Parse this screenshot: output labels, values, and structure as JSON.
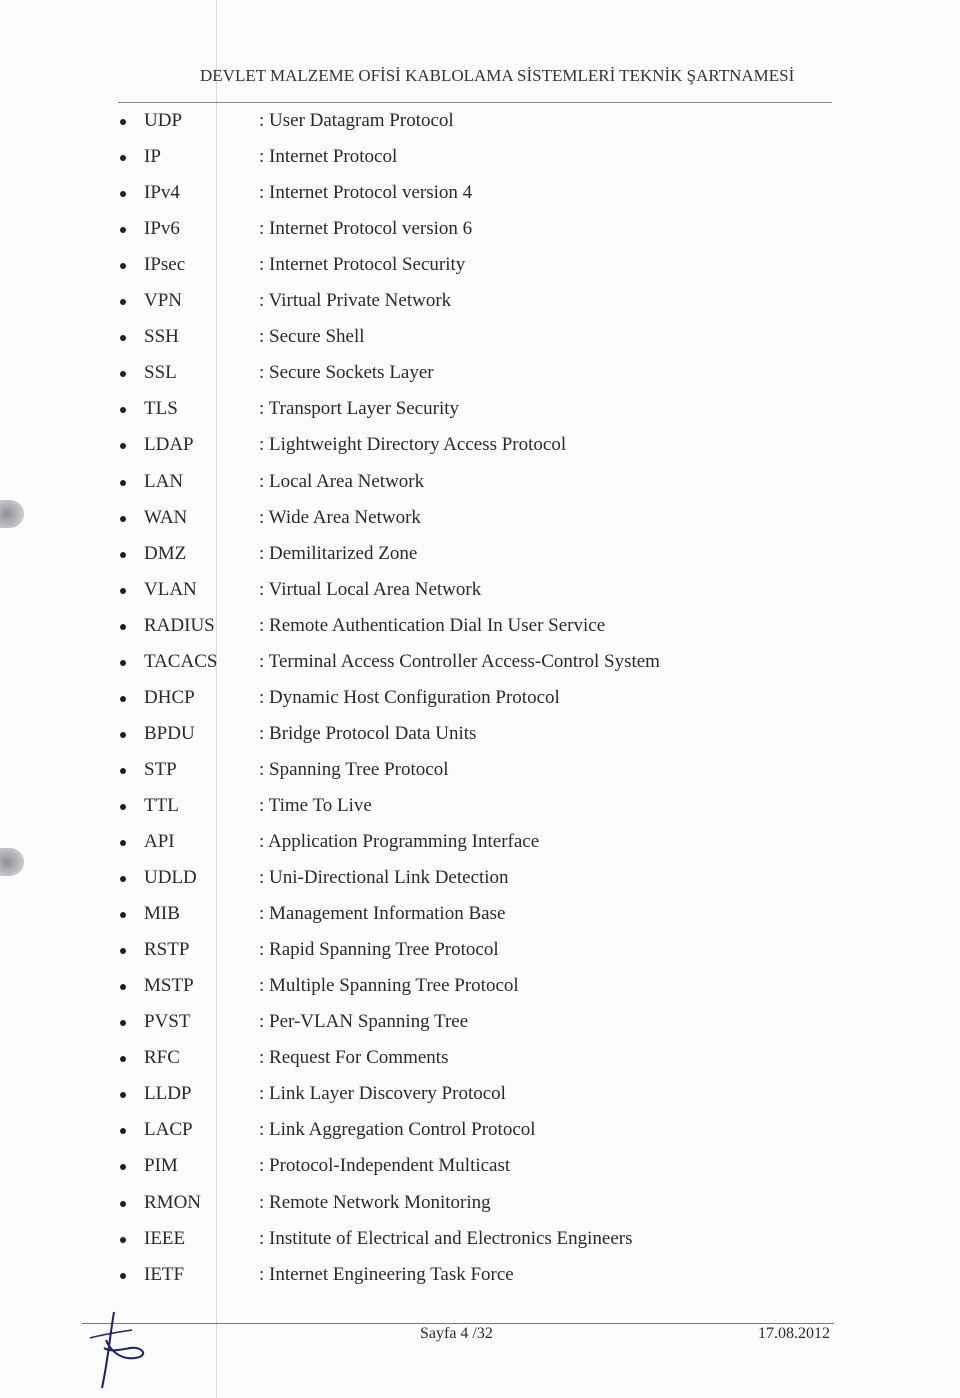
{
  "header": {
    "title": "DEVLET MALZEME OFİSİ KABLOLAMA SİSTEMLERİ TEKNİK ŞARTNAMESİ"
  },
  "separator": ":",
  "items": [
    {
      "abbr": "UDP",
      "desc": ": User Datagram Protocol"
    },
    {
      "abbr": "IP",
      "desc": ": Internet Protocol"
    },
    {
      "abbr": "IPv4",
      "desc": ": Internet Protocol version 4"
    },
    {
      "abbr": "IPv6",
      "desc": ": Internet Protocol version 6"
    },
    {
      "abbr": "IPsec",
      "desc": ": Internet Protocol Security"
    },
    {
      "abbr": "VPN",
      "desc": ": Virtual Private Network"
    },
    {
      "abbr": "SSH",
      "desc": ": Secure Shell"
    },
    {
      "abbr": "SSL",
      "desc": ": Secure Sockets Layer"
    },
    {
      "abbr": "TLS",
      "desc": ": Transport Layer Security"
    },
    {
      "abbr": "LDAP",
      "desc": ": Lightweight Directory Access Protocol"
    },
    {
      "abbr": "LAN",
      "desc": ": Local Area Network"
    },
    {
      "abbr": "WAN",
      "desc": ": Wide Area Network"
    },
    {
      "abbr": "DMZ",
      "desc": ": Demilitarized Zone"
    },
    {
      "abbr": "VLAN",
      "desc": ": Virtual Local Area Network"
    },
    {
      "abbr": "RADIUS",
      "desc": ": Remote Authentication Dial In User Service"
    },
    {
      "abbr": "TACACS",
      "desc": ": Terminal Access Controller Access-Control System"
    },
    {
      "abbr": "DHCP",
      "desc": ": Dynamic Host Configuration Protocol"
    },
    {
      "abbr": "BPDU",
      "desc": ": Bridge Protocol Data Units"
    },
    {
      "abbr": "STP",
      "desc": ": Spanning Tree Protocol"
    },
    {
      "abbr": "TTL",
      "desc": ": Time To Live"
    },
    {
      "abbr": "API",
      "desc": ": Application Programming Interface"
    },
    {
      "abbr": "UDLD",
      "desc": ": Uni-Directional Link Detection"
    },
    {
      "abbr": "MIB",
      "desc": ": Management Information Base"
    },
    {
      "abbr": "RSTP",
      "desc": ": Rapid Spanning Tree Protocol"
    },
    {
      "abbr": "MSTP",
      "desc": ": Multiple Spanning Tree Protocol"
    },
    {
      "abbr": "PVST",
      "desc": ": Per-VLAN Spanning Tree"
    },
    {
      "abbr": "RFC",
      "desc": ": Request For Comments"
    },
    {
      "abbr": "LLDP",
      "desc": ": Link Layer Discovery Protocol"
    },
    {
      "abbr": "LACP",
      "desc": ": Link Aggregation Control Protocol"
    },
    {
      "abbr": "PIM",
      "desc": ": Protocol-Independent Multicast"
    },
    {
      "abbr": "RMON",
      "desc": ": Remote Network Monitoring"
    },
    {
      "abbr": "IEEE",
      "desc": ": Institute of Electrical and Electronics Engineers"
    },
    {
      "abbr": "IETF",
      "desc": ": Internet Engineering Task Force"
    }
  ],
  "footer": {
    "page": "Sayfa 4 /32",
    "date": "17.08.2012"
  },
  "colors": {
    "text": "#2a2a2a",
    "signature": "#1f1f6b"
  }
}
